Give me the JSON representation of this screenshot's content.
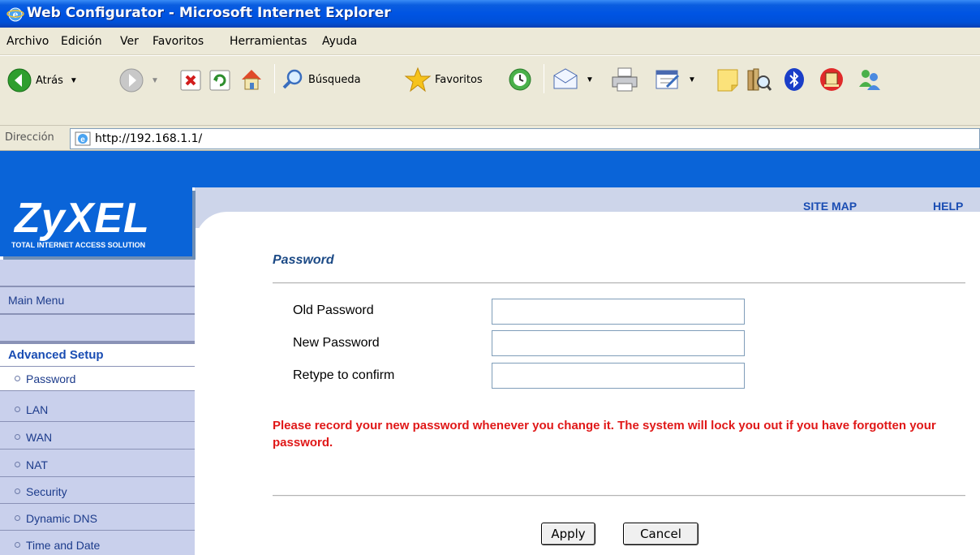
{
  "window": {
    "title": "Web Configurator - Microsoft Internet Explorer"
  },
  "menubar": {
    "items": [
      "Archivo",
      "Edición",
      "Ver",
      "Favoritos",
      "Herramientas",
      "Ayuda"
    ]
  },
  "toolbar": {
    "back_label": "Atrás",
    "search_label": "Búsqueda",
    "favorites_label": "Favoritos"
  },
  "addressbar": {
    "label": "Dirección",
    "url": "http://192.168.1.1/"
  },
  "brand": {
    "logo": "ZyXEL",
    "tagline": "TOTAL INTERNET ACCESS SOLUTION",
    "color": "#0a64d8"
  },
  "topnav": {
    "site_map": "SITE MAP",
    "help": "HELP"
  },
  "sidebar": {
    "main_menu": "Main Menu",
    "section": "Advanced Setup",
    "items": [
      "Password",
      "LAN",
      "WAN",
      "NAT",
      "Security",
      "Dynamic DNS",
      "Time and Date"
    ],
    "selected": "Password"
  },
  "form": {
    "title": "Password",
    "fields": [
      {
        "label": "Old Password",
        "value": ""
      },
      {
        "label": "New Password",
        "value": ""
      },
      {
        "label": "Retype to confirm",
        "value": ""
      }
    ],
    "warning": "Please record your new password whenever you change it. The system will lock you out if you have forgotten your password.",
    "warning_color": "#e01818",
    "apply_label": "Apply",
    "cancel_label": "Cancel"
  }
}
